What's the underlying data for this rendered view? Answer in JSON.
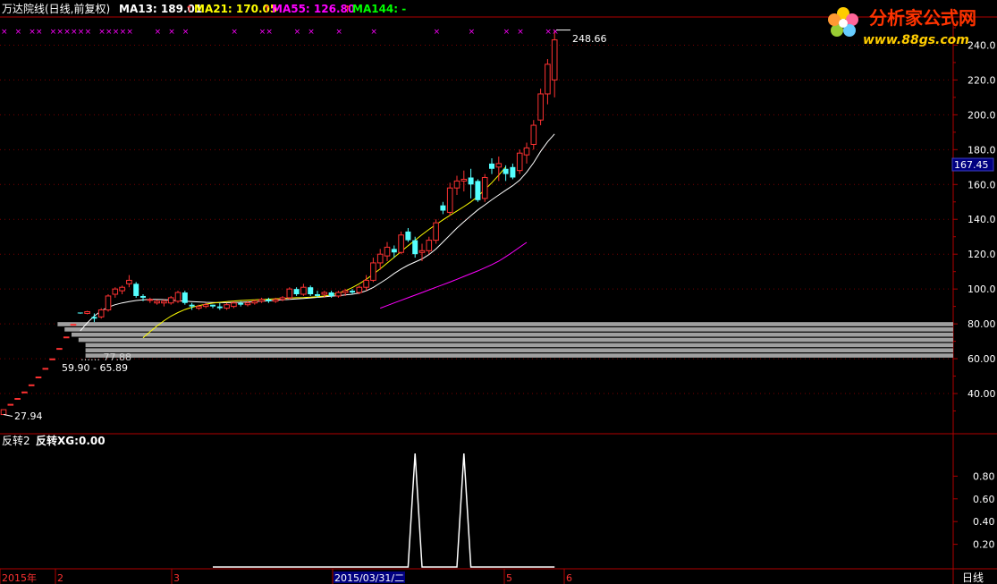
{
  "header": {
    "title": "万达院线(日线,前复权)",
    "ma": [
      {
        "label": "MA13:",
        "value": "189.01",
        "color": "#ffffff"
      },
      {
        "label": "MA21:",
        "value": "170.05",
        "color": "#ffff00"
      },
      {
        "label": "MA55:",
        "value": "126.80",
        "color": "#ff00ff"
      },
      {
        "label": "MA144:",
        "value": "-",
        "color": "#00ff00"
      }
    ],
    "arrow": "↑"
  },
  "watermark": {
    "name": "分析家公式网",
    "url": "www.88gs.com"
  },
  "annotations": {
    "high": "248.66",
    "low": "27.94",
    "range": "59.90 - 65.89",
    "range_hidden": "…… 77.88",
    "current_price": "167.45"
  },
  "colors": {
    "up": "#ff3232",
    "down": "#54ffff",
    "frame": "#b00000",
    "ma13": "#ffffff",
    "ma21": "#ffff00",
    "ma55": "#ff00ff",
    "volume_bar": "#a0a0a0",
    "signal_line": "#ffffff",
    "signal_mark": "#ff00ff",
    "price_box": "#000080"
  },
  "lower_panel": {
    "title": "反转2",
    "label": "反转XG:",
    "value": "0.00"
  },
  "x_axis": {
    "labels": [
      "2015年",
      "2",
      "3",
      "2015/03/31/二",
      "5",
      "6"
    ],
    "period": "日线"
  },
  "chart_data": [
    {
      "type": "candlestick",
      "ylim": [
        20,
        250
      ],
      "yticks": [
        40,
        60,
        80,
        100,
        120,
        140,
        160,
        180,
        200,
        220,
        240
      ],
      "ytick_labels": [
        "40.00",
        "60.00",
        "80.00",
        "100.0",
        "120.0",
        "140.0",
        "160.0",
        "180.0",
        "200.0",
        "220.0",
        "240.0"
      ],
      "candles": [
        [
          27.94,
          30.74,
          27.94,
          30.74
        ],
        [
          33.81,
          33.81,
          33.81,
          33.81
        ],
        [
          37.19,
          37.19,
          37.19,
          37.19
        ],
        [
          40.91,
          40.91,
          40.91,
          40.91
        ],
        [
          45.0,
          45.0,
          45.0,
          45.0
        ],
        [
          49.5,
          49.5,
          49.5,
          49.5
        ],
        [
          54.45,
          54.45,
          54.45,
          54.45
        ],
        [
          59.9,
          59.9,
          59.9,
          59.9
        ],
        [
          65.89,
          65.89,
          65.89,
          65.89
        ],
        [
          72.48,
          72.48,
          72.48,
          72.48
        ],
        [
          79.73,
          79.73,
          79.73,
          79.73
        ],
        [
          86.5,
          86.5,
          85.8,
          86.0
        ],
        [
          86.0,
          87.5,
          85.5,
          87.0
        ],
        [
          84.0,
          86.0,
          81.0,
          83.0
        ],
        [
          84.0,
          89.0,
          83.0,
          88.0
        ],
        [
          88.0,
          97.0,
          87.0,
          96.0
        ],
        [
          97.0,
          101.0,
          95.0,
          100.0
        ],
        [
          99.0,
          102.0,
          97.0,
          101.0
        ],
        [
          103.0,
          108.0,
          101.0,
          105.0
        ],
        [
          103.0,
          104.0,
          95.0,
          96.0
        ],
        [
          96.0,
          97.0,
          93.0,
          95.0
        ],
        [
          94.0,
          95.0,
          92.0,
          94.0
        ],
        [
          92.0,
          94.0,
          91.0,
          93.0
        ],
        [
          92.0,
          94.0,
          90.0,
          93.0
        ],
        [
          92.0,
          96.0,
          91.0,
          95.0
        ],
        [
          93.0,
          99.0,
          92.0,
          98.0
        ],
        [
          98.0,
          99.0,
          91.0,
          92.0
        ],
        [
          91.0,
          92.0,
          88.0,
          90.0
        ],
        [
          89.0,
          91.0,
          88.0,
          90.0
        ],
        [
          90.0,
          92.0,
          89.0,
          91.0
        ],
        [
          91.0,
          91.0,
          89.0,
          90.0
        ],
        [
          90.0,
          92.0,
          88.0,
          89.0
        ],
        [
          89.0,
          92.0,
          88.0,
          91.0
        ],
        [
          90.0,
          93.0,
          89.0,
          92.0
        ],
        [
          92.0,
          93.0,
          90.0,
          91.0
        ],
        [
          91.0,
          93.0,
          90.0,
          92.0
        ],
        [
          92.0,
          94.0,
          91.0,
          93.0
        ],
        [
          93.0,
          95.0,
          92.0,
          94.0
        ],
        [
          94.0,
          95.0,
          92.0,
          93.0
        ],
        [
          93.0,
          95.0,
          92.0,
          94.0
        ],
        [
          94.0,
          96.0,
          93.0,
          95.0
        ],
        [
          95.0,
          101.0,
          94.0,
          100.0
        ],
        [
          100.0,
          101.0,
          96.0,
          97.0
        ],
        [
          97.0,
          103.0,
          96.0,
          101.0
        ],
        [
          101.0,
          102.0,
          96.0,
          97.0
        ],
        [
          97.0,
          99.0,
          95.0,
          96.0
        ],
        [
          97.0,
          99.0,
          95.0,
          98.0
        ],
        [
          98.0,
          99.0,
          95.0,
          96.0
        ],
        [
          96.0,
          99.0,
          95.0,
          98.0
        ],
        [
          98.0,
          100.0,
          96.0,
          99.0
        ],
        [
          99.0,
          100.0,
          97.0,
          98.0
        ],
        [
          98.0,
          102.0,
          97.0,
          101.0
        ],
        [
          101.0,
          108.0,
          99.0,
          105.0
        ],
        [
          105.0,
          118.0,
          104.0,
          115.0
        ],
        [
          115.0,
          123.0,
          111.0,
          120.0
        ],
        [
          119.0,
          127.0,
          116.0,
          124.0
        ],
        [
          123.0,
          125.0,
          118.0,
          121.0
        ],
        [
          121.0,
          133.0,
          120.0,
          131.0
        ],
        [
          133.0,
          135.0,
          127.0,
          128.0
        ],
        [
          128.0,
          130.0,
          118.0,
          120.0
        ],
        [
          121.0,
          126.0,
          116.0,
          122.0
        ],
        [
          122.0,
          130.0,
          120.0,
          128.0
        ],
        [
          128.0,
          140.0,
          126.0,
          138.0
        ],
        [
          148.0,
          150.0,
          143.0,
          145.0
        ],
        [
          144.0,
          161.0,
          142.0,
          158.0
        ],
        [
          158.0,
          165.0,
          154.0,
          162.0
        ],
        [
          162.0,
          168.0,
          156.0,
          163.0
        ],
        [
          164.0,
          169.0,
          152.0,
          160.0
        ],
        [
          162.0,
          163.0,
          150.0,
          151.0
        ],
        [
          152.0,
          166.0,
          150.0,
          164.0
        ],
        [
          172.0,
          175.0,
          166.0,
          169.0
        ],
        [
          170.0,
          176.0,
          162.0,
          172.0
        ],
        [
          169.0,
          171.0,
          162.0,
          166.0
        ],
        [
          170.0,
          172.0,
          163.0,
          164.0
        ],
        [
          168.0,
          180.0,
          166.0,
          178.0
        ],
        [
          177.0,
          184.0,
          172.0,
          181.0
        ],
        [
          183.0,
          197.0,
          180.0,
          194.0
        ],
        [
          197.0,
          215.0,
          194.0,
          212.0
        ],
        [
          212.0,
          232.0,
          206.0,
          229.0
        ],
        [
          220.0,
          248.66,
          210.0,
          243.0
        ]
      ],
      "ma13_from": 11,
      "ma13": [
        76.0,
        80.6,
        84.5,
        87.5,
        89.6,
        91.0,
        92.0,
        92.8,
        93.4,
        93.8,
        94.0,
        94.0,
        93.9,
        93.6,
        93.3,
        93.0,
        92.8,
        92.6,
        92.4,
        92.3,
        92.2,
        92.2,
        92.3,
        92.4,
        92.6,
        92.8,
        93.0,
        93.2,
        93.5,
        93.8,
        94.0,
        94.3,
        94.6,
        94.9,
        95.2,
        95.5,
        95.9,
        96.2,
        96.6,
        97.0,
        97.7,
        99.0,
        100.9,
        103.4,
        106.0,
        108.9,
        111.5,
        113.7,
        115.5,
        117.3,
        119.8,
        123.0,
        127.0,
        131.0,
        135.0,
        138.6,
        142.0,
        145.4,
        148.3,
        151.2,
        154.0,
        156.7,
        159.3,
        162.5,
        167.0,
        172.5,
        179.0,
        184.5,
        189.01
      ],
      "ma21_from": 20,
      "ma21": [
        72.0,
        75.5,
        78.8,
        81.8,
        84.4,
        86.5,
        88.2,
        89.5,
        90.5,
        91.3,
        91.9,
        92.4,
        92.8,
        93.1,
        93.4,
        93.6,
        93.8,
        94.0,
        94.2,
        94.4,
        94.6,
        94.8,
        95.0,
        95.1,
        95.3,
        95.6,
        96.0,
        96.6,
        97.6,
        99.0,
        100.8,
        103.0,
        105.6,
        108.5,
        111.6,
        114.9,
        118.2,
        121.5,
        124.8,
        128.0,
        131.2,
        134.2,
        137.0,
        139.7,
        142.3,
        144.8,
        147.3,
        150.0,
        153.2,
        157.0,
        161.0,
        165.4,
        170.05
      ],
      "ma55_from": 54,
      "ma55": [
        89.0,
        90.5,
        92.0,
        93.5,
        95.0,
        96.5,
        98.0,
        99.5,
        101.0,
        102.5,
        104.0,
        105.6,
        107.2,
        108.8,
        110.4,
        112.2,
        114.0,
        116.0,
        118.5,
        121.2,
        124.0,
        126.8
      ],
      "signal_marks": [
        0,
        2,
        4,
        5,
        7,
        8,
        9,
        10,
        11,
        12,
        14,
        15,
        16,
        17,
        18,
        22,
        24,
        26,
        33,
        37,
        38,
        42,
        44,
        48,
        53,
        62,
        67,
        72,
        74,
        78,
        79
      ],
      "volume_bars": [
        {
          "start": 8,
          "top": 81,
          "bottom": 78
        },
        {
          "start": 9,
          "top": 78,
          "bottom": 75
        },
        {
          "start": 10,
          "top": 75,
          "bottom": 72
        },
        {
          "start": 11,
          "top": 72,
          "bottom": 69
        },
        {
          "start": 12,
          "top": 69,
          "bottom": 66
        },
        {
          "start": 12,
          "top": 66,
          "bottom": 63
        },
        {
          "start": 12,
          "top": 63,
          "bottom": 60
        }
      ]
    },
    {
      "type": "line",
      "title": "反转XG",
      "ylim": [
        0,
        1.05
      ],
      "yticks": [
        0.2,
        0.4,
        0.6,
        0.8
      ],
      "ytick_labels": [
        "0.20",
        "0.40",
        "0.60",
        "0.80"
      ],
      "x_start": 30,
      "x_end": 79,
      "spikes": [
        59,
        66
      ],
      "spike_value": 1.0
    }
  ]
}
